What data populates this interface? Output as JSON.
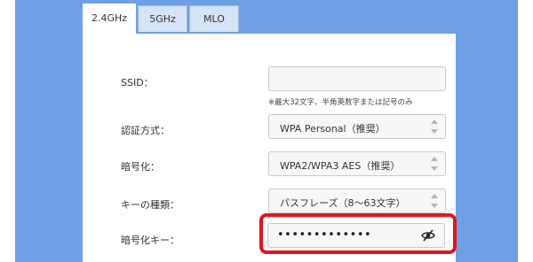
{
  "tabs": [
    "2.4GHz",
    "5GHz",
    "MLO"
  ],
  "ssid": {
    "label": "SSID：",
    "value": "",
    "hint": "※最大32文字、半角英数字または記号のみ"
  },
  "auth": {
    "label": "認証方式：",
    "value": "WPA Personal（推奨）"
  },
  "encryption": {
    "label": "暗号化：",
    "value": "WPA2/WPA3 AES（推奨）"
  },
  "key_type": {
    "label": "キーの種類：",
    "value": "パスフレーズ（8～63文字）"
  },
  "key": {
    "label": "暗号化キー：",
    "value": "•••••••••••••",
    "icon": "eye-off-icon"
  },
  "colors": {
    "background": "#6fa0e6",
    "highlight": "#e3141c"
  }
}
